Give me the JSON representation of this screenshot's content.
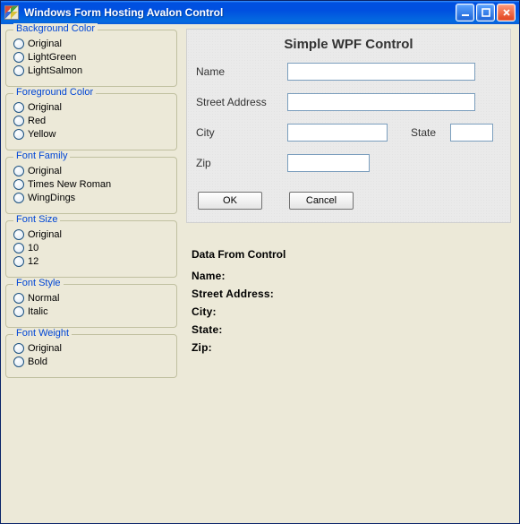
{
  "window": {
    "title": "Windows Form Hosting Avalon Control"
  },
  "groups": {
    "bgcolor": {
      "legend": "Background Color",
      "options": [
        "Original",
        "LightGreen",
        "LightSalmon"
      ]
    },
    "fgcolor": {
      "legend": "Foreground Color",
      "options": [
        "Original",
        "Red",
        "Yellow"
      ]
    },
    "fontfamily": {
      "legend": "Font Family",
      "options": [
        "Original",
        "Times New Roman",
        "WingDings"
      ]
    },
    "fontsize": {
      "legend": "Font Size",
      "options": [
        "Original",
        "10",
        "12"
      ]
    },
    "fontstyle": {
      "legend": "Font Style",
      "options": [
        "Normal",
        "Italic"
      ]
    },
    "fontweight": {
      "legend": "Font Weight",
      "options": [
        "Original",
        "Bold"
      ]
    }
  },
  "wpf": {
    "title": "Simple WPF Control",
    "labels": {
      "name": "Name",
      "street": "Street Address",
      "city": "City",
      "state": "State",
      "zip": "Zip"
    },
    "values": {
      "name": "",
      "street": "",
      "city": "",
      "state": "",
      "zip": ""
    },
    "buttons": {
      "ok": "OK",
      "cancel": "Cancel"
    }
  },
  "output": {
    "header": "Data From Control",
    "lines": {
      "name": "Name:",
      "street": "Street Address:",
      "city": "City:",
      "state": "State:",
      "zip": "Zip:"
    }
  }
}
